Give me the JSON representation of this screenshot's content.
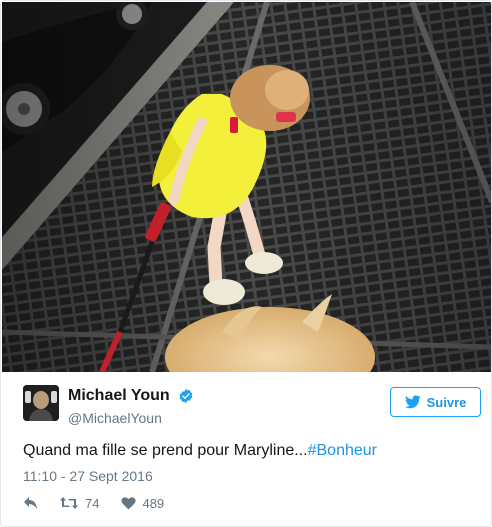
{
  "tweet": {
    "author_name": "Michael Youn",
    "author_handle": "@MichaelYoun",
    "verified": true,
    "follow_label": "Suivre",
    "text_main": "Quand ma fille se prend pour Maryline...",
    "hashtag": "#Bonheur",
    "timestamp": "11:10 - 27 Sept 2016",
    "retweet_count": "74",
    "like_count": "489"
  },
  "icons": {
    "verified": "verified-badge-icon",
    "follow": "twitter-bird-icon",
    "reply": "reply-icon",
    "retweet": "retweet-icon",
    "like": "heart-icon"
  },
  "colors": {
    "accent": "#1da1f2",
    "link": "#1b95e0",
    "secondary_text": "#657786",
    "primary_text": "#14171a",
    "border": "#e1e8ed"
  }
}
